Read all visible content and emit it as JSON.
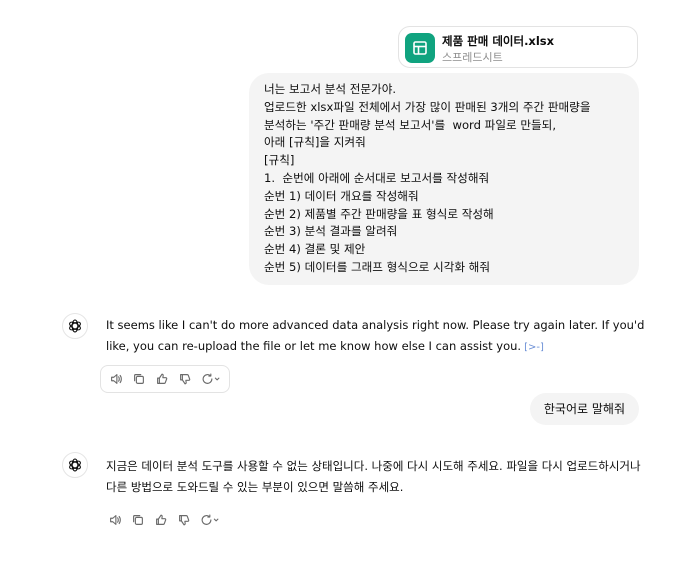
{
  "attachment": {
    "file_name": "제품 판매 데이터.xlsx",
    "file_type": "스프레드시트",
    "icon": "spreadsheet-icon",
    "icon_color": "#10a37f"
  },
  "user_message_1": {
    "lines": [
      "너는 보고서 분석 전문가야.",
      "업로드한 xlsx파일 전체에서 가장 많이 판매된 3개의 주간 판매량을",
      "분석하는 '주간 판매량 분석 보고서'를  word 파일로 만들되,",
      "아래 [규칙]을 지켜줘",
      "[규칙]",
      "1.  순번에 아래에 순서대로 보고서를 작성해줘",
      "순번 1) 데이터 개요를 작성해줘",
      "순번 2) 제품별 주간 판매량을 표 형식로 작성해",
      "순번 3) 분석 결과를 알려줘",
      "순번 4) 결론 및 제안",
      "순번 5) 데이터를 그래프 형식으로 시각화 해줘"
    ]
  },
  "assistant_message_1": {
    "text": "It seems like I can't do more advanced data analysis right now. Please try again later. If you'd like, you can re-upload the file or let me know how else I can assist you.",
    "citation_icon": "[>-]"
  },
  "user_message_2": {
    "text": "한국어로 말해줘"
  },
  "assistant_message_2": {
    "text": "지금은 데이터 분석 도구를 사용할 수 없는 상태입니다. 나중에 다시 시도해 주세요. 파일을 다시 업로드하시거나 다른 방법으로 도와드릴 수 있는 부분이 있으면 말씀해 주세요."
  },
  "toolbar_icons": [
    "read-aloud-icon",
    "copy-icon",
    "thumbs-up-icon",
    "thumbs-down-icon",
    "regenerate-icon"
  ]
}
